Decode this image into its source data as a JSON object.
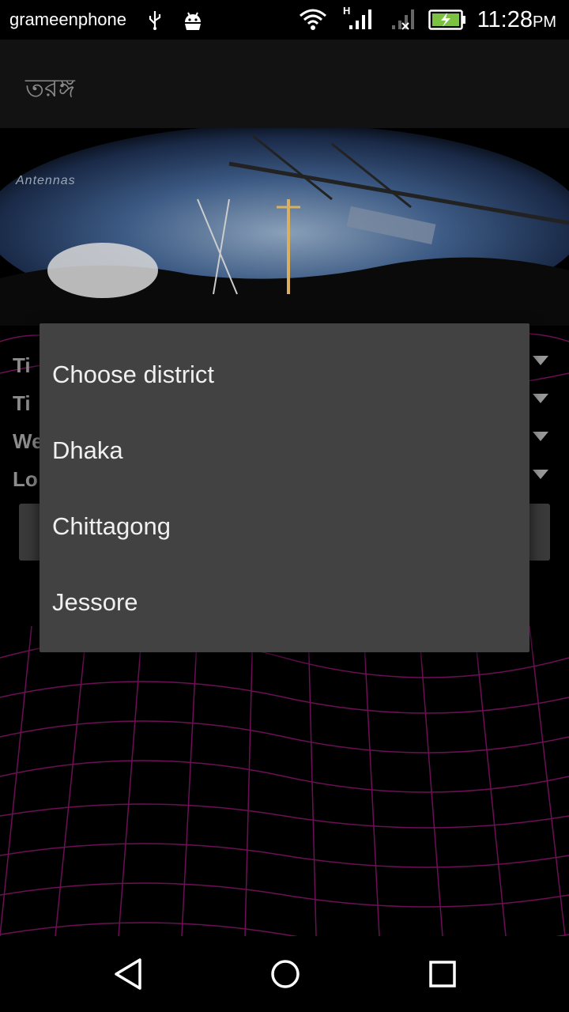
{
  "status_bar": {
    "carrier": "grameenphone",
    "time": "11:28",
    "ampm": "PM",
    "network_type": "H"
  },
  "app_bar": {
    "title": "তরঙ্গ"
  },
  "banner": {
    "caption": "Antennas"
  },
  "background_rows": [
    {
      "label": "Ti"
    },
    {
      "label": "Ti"
    },
    {
      "label": "We"
    },
    {
      "label": "Lo"
    }
  ],
  "district_dialog": {
    "options": [
      "Choose district",
      "Dhaka",
      "Chittagong",
      "Jessore"
    ]
  },
  "colors": {
    "dialog_bg": "#424242",
    "grid_magenta": "#8a1466",
    "app_bar_bg": "#121212"
  },
  "icons": [
    "usb-icon",
    "android-icon",
    "wifi-icon",
    "signal-icon",
    "no-signal-icon",
    "battery-charging-icon",
    "back-icon",
    "home-icon",
    "recents-icon"
  ]
}
